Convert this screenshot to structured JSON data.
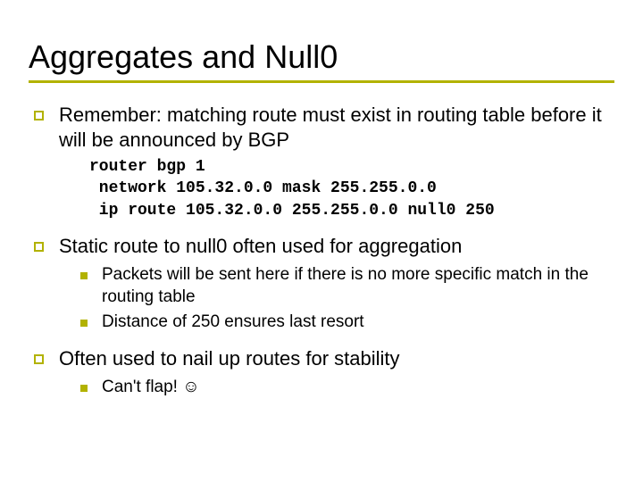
{
  "title": "Aggregates and Null0",
  "bullets": {
    "b1": "Remember: matching route must exist in routing table before it will be announced by BGP",
    "b2": "Static route to null0 often used for aggregation",
    "b2_sub1": "Packets will be sent here if there is no more specific match in the routing table",
    "b2_sub2": "Distance of 250 ensures last resort",
    "b3": "Often used to nail up routes for stability",
    "b3_sub1": "Can't flap! ☺"
  },
  "code": "router bgp 1\n network 105.32.0.0 mask 255.255.0.0\n ip route 105.32.0.0 255.255.0.0 null0 250"
}
